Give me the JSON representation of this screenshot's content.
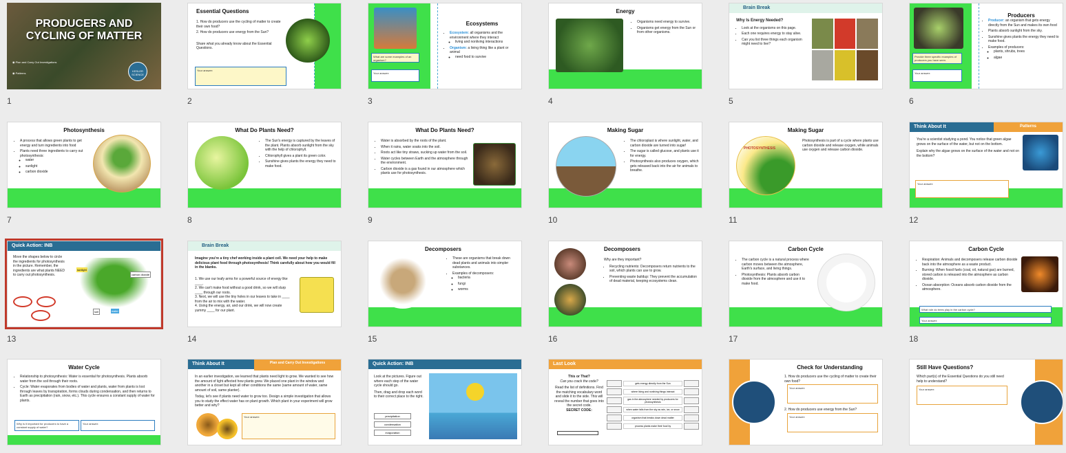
{
  "slides": [
    {
      "n": "1",
      "title": "PRODUCERS AND CYCLING OF MATTER",
      "l1": "Plan and Carry Out Investigations",
      "l2": "Patterns",
      "logo": "KESLER SCIENCE"
    },
    {
      "n": "2",
      "title": "Essential Questions",
      "q1": "How do producers use the cycling of matter to create their own food?",
      "q2": "How do producers use energy from the Sun?",
      "p": "Share what you already know about the Essential Questions.",
      "ans": "Your answer:"
    },
    {
      "n": "3",
      "title": "Ecosystems",
      "b1k": "Ecosystem:",
      "b1": "all organisms and the environment where they interact",
      "b1s": "living and nonliving interactions",
      "b2k": "Organism:",
      "b2": "a living thing like a plant or animal",
      "b2s": "need food to survive",
      "prompt": "What are some examples of an organism?",
      "ans": "Your answer:"
    },
    {
      "n": "4",
      "title": "Energy",
      "b1": "Organisms need energy to survive.",
      "b2": "Organisms get energy from the Sun or from other organisms."
    },
    {
      "n": "5",
      "hdr": "Brain Break",
      "title": "Why Is Energy Needed?",
      "b1": "Look at the organisms on this page.",
      "b2": "Each one requires energy to stay alive.",
      "b3": "Can you list three things each organism might need to live?"
    },
    {
      "n": "6",
      "title": "Producers",
      "b1k": "Producer:",
      "b1": "an organism that gets energy directly from the Sun and makes its own food",
      "b2": "Plants absorb sunlight from the sky.",
      "b3": "Sunshine gives plants the energy they need to make food.",
      "b4": "Examples of producers:",
      "s1": "plants, shrubs, trees",
      "s2": "algae",
      "prompt": "Provide three specific examples of producers you have seen.",
      "ans": "Your answer:"
    },
    {
      "n": "7",
      "title": "Photosynthesis",
      "b1": "A process that allows green plants to get energy and turn ingredients into food",
      "b2": "Plants need three ingredients to carry out photosynthesis:",
      "s1": "water",
      "s2": "sunlight",
      "s3": "carbon dioxide"
    },
    {
      "n": "8",
      "title": "What Do Plants Need?",
      "b1": "The Sun's energy is captured by the leaves of the plant. Plants absorb sunlight from the sky with the help of chlorophyll.",
      "b2": "Chlorophyll gives a plant its green color.",
      "b3": "Sunshine gives plants the energy they need to make food."
    },
    {
      "n": "9",
      "title": "What Do Plants Need?",
      "b1": "Water is absorbed by the roots of the plant.",
      "b2": "When it rains, water soaks into the soil.",
      "b3": "Roots act like tiny straws, sucking up water from the soil.",
      "b4": "Water cycles between Earth and the atmosphere through the environment.",
      "b5": "Carbon dioxide is a gas found in our atmosphere which plants use for photosynthesis."
    },
    {
      "n": "10",
      "title": "Making Sugar",
      "b1": "The chloroplast is where sunlight, water, and carbon dioxide are turned into sugar!",
      "b2": "The sugar is called glucose, and plants use it for energy.",
      "b3": "Photosynthesis also produces oxygen, which gets released back into the air for animals to breathe."
    },
    {
      "n": "11",
      "title": "Making Sugar",
      "b1": "Photosynthesis is part of a cycle where plants use carbon dioxide and release oxygen, while animals use oxygen and release carbon dioxide.",
      "lbl": "PHOTOSYNTHESIS"
    },
    {
      "n": "12",
      "hdr": "Think About It",
      "tag": "Patterns",
      "b1": "You're a scientist studying a pond. You notice that green algae grows on the surface of the water, but not on the bottom.",
      "b2": "Explain why the algae grows on the surface of the water and not on the bottom?",
      "ans": "Your answer:"
    },
    {
      "n": "13",
      "hdr": "Quick Action: INB",
      "b1": "Move the shapes below to circle the ingredients for photosynthesis in the picture. Remember, the ingredients are what plants NEED to carry out photosynthesis.",
      "w1": "sunlight",
      "w2": "carbon dioxide",
      "w3": "soil",
      "w4": "water"
    },
    {
      "n": "14",
      "hdr": "Brain Break",
      "intro": "Imagine you're a tiny chef working inside a plant cell. We need your help to make delicious plant food through photosynthesis! Think carefully about how you would fill in the blanks.",
      "i1": "We use our leafy arms for a powerful source of energy like ____.",
      "i2": "We can't make food without a good drink, so we will slurp ____ through our roots.",
      "i3": "Next, we will use the tiny holes in our leaves to take in ____ from the air to mix with the water.",
      "i4": "Using the energy, air, and our drink, we will now create yummy ____ for our plant."
    },
    {
      "n": "15",
      "title": "Decomposers",
      "b1": "These are organisms that break down dead plants and animals into simpler substances.",
      "b2": "Examples of decomposers:",
      "s1": "bacteria",
      "s2": "fungi",
      "s3": "worms"
    },
    {
      "n": "16",
      "title": "Decomposers",
      "p": "Why are they important?",
      "b1": "Recycling nutrients: Decomposers return nutrients to the soil, which plants can use to grow.",
      "b2": "Preventing waste buildup: They prevent the accumulation of dead material, keeping ecosystems clean."
    },
    {
      "n": "17",
      "title": "Carbon Cycle",
      "b1": "The carbon cycle is a natural process where carbon moves between the atmosphere, Earth's surface, and living things.",
      "b2": "Photosynthesis: Plants absorb carbon dioxide from the atmosphere and use it to make food."
    },
    {
      "n": "18",
      "title": "Carbon Cycle",
      "b1": "Respiration: Animals and decomposers release carbon dioxide back into the atmosphere as a waste product.",
      "b2": "Burning: When fossil fuels (coal, oil, natural gas) are burned, stored carbon is released into the atmosphere as carbon dioxide.",
      "b3": "Ocean absorption: Oceans absorb carbon dioxide from the atmosphere.",
      "prompt": "What role do trees play in the carbon cycle?",
      "ans": "Your answer:"
    },
    {
      "n": "19",
      "title": "Water Cycle",
      "b1": "Relationship to photosynthesis: Water is essential for photosynthesis. Plants absorb water from the soil through their roots.",
      "b2": "Cycle: Water evaporates from bodies of water and plants, water from plants is lost through leaves by transpiration, forms clouds during condensation, and then returns to Earth as precipitation (rain, snow, etc.). This cycle ensures a constant supply of water for plants.",
      "prompt": "Why is it important for producers to have a constant supply of water?",
      "ans": "Your answer:"
    },
    {
      "n": "20",
      "hdr": "Think About It",
      "tag": "Plan and Carry Out Investigations",
      "b1": "In an earlier investigation, we learned that plants need light to grow. We wanted to see how the amount of light affected how plants grew. We placed one plant in the window and another in a closet but kept all other conditions the same (same amount of water, same amount of soil, same planter).",
      "b2": "Today, let's see if plants need water to grow too. Design a simple investigation that allows you to study the effect water has on plant growth. Which plant in your experiment will grow better and why?",
      "ans": "Your answer:"
    },
    {
      "n": "21",
      "hdr": "Quick Action: INB",
      "b1": "Look at the pictures. Figure out where each step of the water cycle should go.",
      "b2": "Then, drag and drop each word to their correct place to the right.",
      "w1": "precipitation",
      "w2": "condensation",
      "w3": "evaporation"
    },
    {
      "n": "22",
      "hdr": "Last Look",
      "t1": "This or That?",
      "t2": "Can you crack the code?",
      "b1": "Read the list of definitions. Find the matching vocabulary word and slide it to the side. This will reveal the number that goes into the secret code.",
      "code": "SECRET CODE:",
      "d1": "gets energy directly from the Sun",
      "d2": "where living and nonliving things interact",
      "d3": "gas in the atmosphere needed by producers for photosynthesis",
      "d4": "when water falls from the sky as rain, ice, or snow",
      "d5": "organism that breaks down dead matter",
      "d6": "process plants make their food by"
    },
    {
      "n": "23",
      "title": "Check for Understanding",
      "q1": "How do producers use the cycling of matter to create their own food?",
      "q2": "How do producers use energy from the Sun?",
      "ans": "Your answer:"
    },
    {
      "n": "24",
      "title": "Still Have Questions?",
      "p": "Which part(s) of the Essential Questions do you still need help to understand?",
      "ans": "Your answer:"
    }
  ],
  "colors": {
    "green": "#3fe04a",
    "blue": "#2a6d93",
    "orange": "#f0a23a",
    "selected": "#c0392b"
  }
}
